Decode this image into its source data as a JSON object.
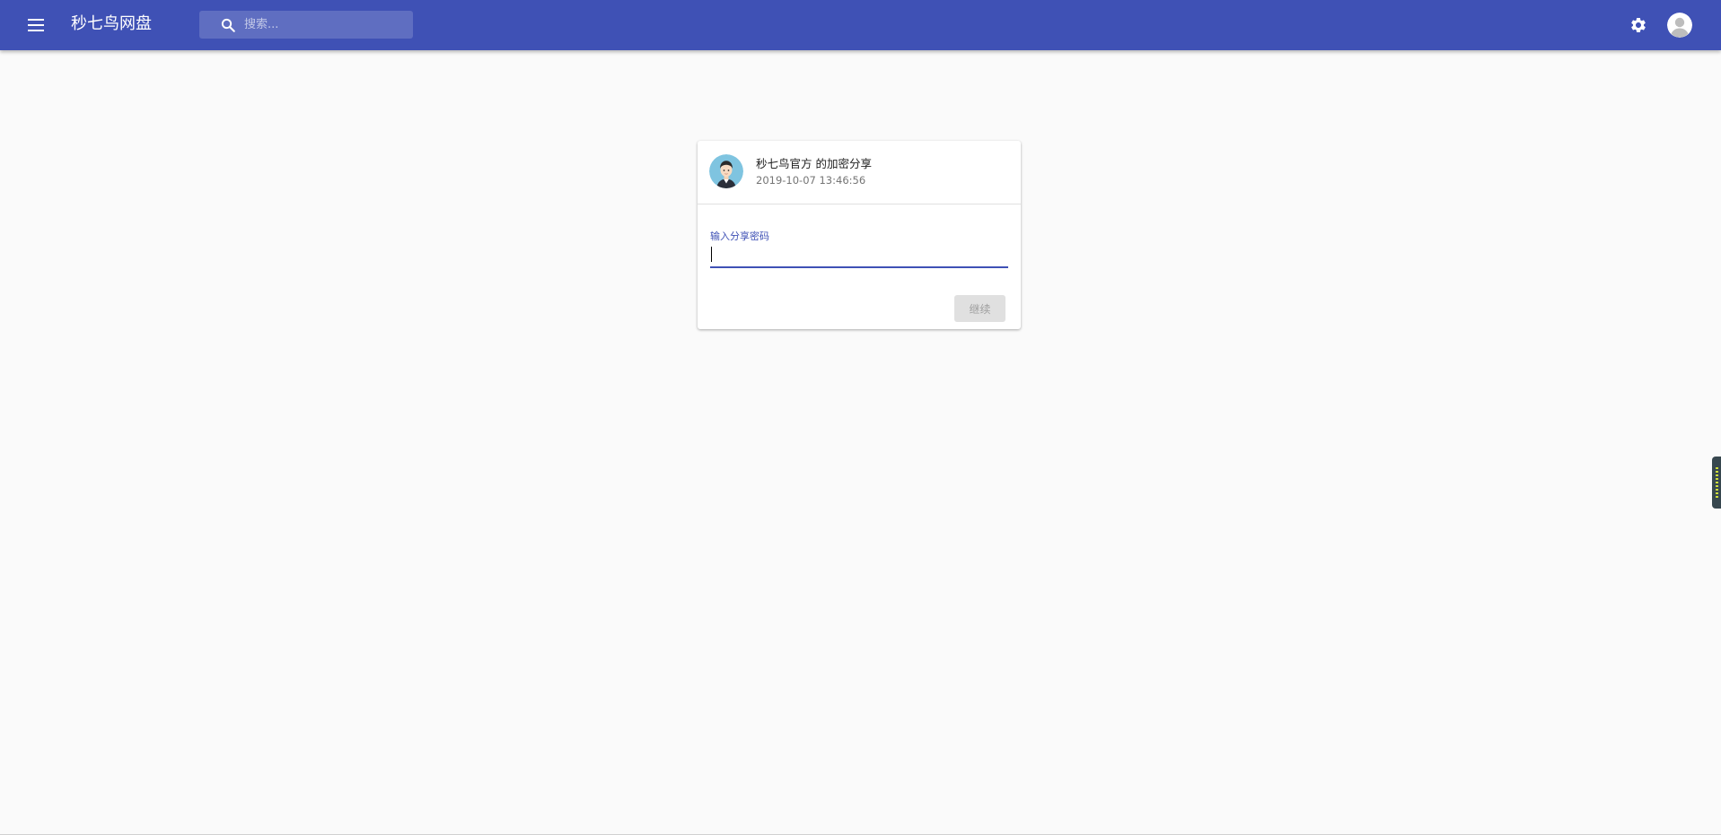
{
  "appbar": {
    "title": "秒七鸟网盘",
    "menu_icon": "menu-icon",
    "search": {
      "placeholder": "搜索...",
      "value": "",
      "icon": "search-icon"
    },
    "settings_icon": "gear-icon",
    "account_icon": "account-avatar-icon",
    "color": "#3f51b5"
  },
  "share_card": {
    "owner_avatar_icon": "user-avatar",
    "title": "秒七鸟官方 的加密分享",
    "created_at": "2019-10-07 13:46:56",
    "password_label": "输入分享密码",
    "password_value": "",
    "continue_label": "继续",
    "continue_disabled": true
  },
  "side_widget": {
    "icon": "side-panel-handle-icon"
  }
}
